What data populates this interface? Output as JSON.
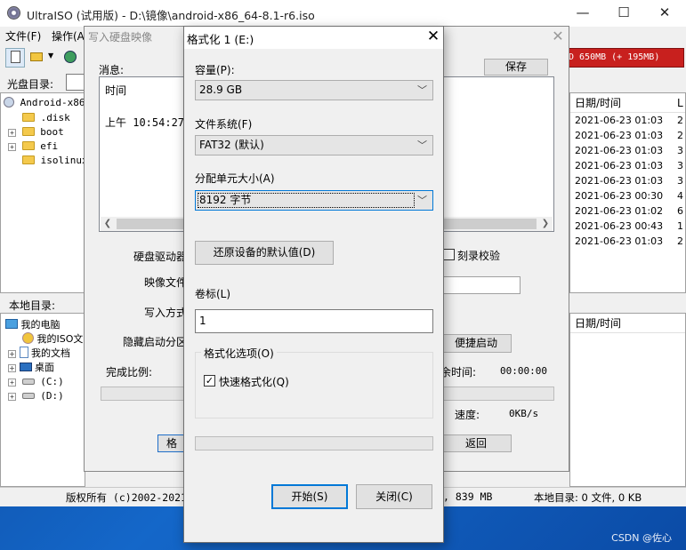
{
  "main_window": {
    "title": "UltraISO (试用版) - D:\\镜像\\android-x86_64-8.1-r6.iso",
    "controls": {
      "minimize": "—",
      "maximize": "☐",
      "close": "✕"
    },
    "menu": [
      "文件(F)",
      "操作(A"
    ],
    "disc_label": "光盘目录:",
    "size_indicator": "D 650MB (+ 195MB)",
    "disc_tree": [
      {
        "label": "Android-x86",
        "icon": "disc-icon"
      },
      {
        "label": ".disk",
        "icon": "folder-icon"
      },
      {
        "label": "boot",
        "icon": "folder-icon"
      },
      {
        "label": "efi",
        "icon": "folder-icon"
      },
      {
        "label": "isolinux",
        "icon": "folder-icon"
      }
    ],
    "local_label": "本地目录:",
    "local_tree": [
      {
        "label": "我的电脑",
        "icon": "computer-icon"
      },
      {
        "label": "我的ISO文",
        "icon": "iso-icon"
      },
      {
        "label": "我的文档",
        "icon": "document-icon"
      },
      {
        "label": "桌面",
        "icon": "desktop-icon"
      },
      {
        "label": "(C:)",
        "icon": "drive-icon"
      },
      {
        "label": "(D:)",
        "icon": "drive-icon"
      }
    ],
    "disc_files": {
      "header": "日期/时间",
      "header_trunc": "L",
      "rows": [
        {
          "date": "2021-06-23 01:03",
          "extra": "2"
        },
        {
          "date": "2021-06-23 01:03",
          "extra": "2"
        },
        {
          "date": "2021-06-23 01:03",
          "extra": "3"
        },
        {
          "date": "2021-06-23 01:03",
          "extra": "3"
        },
        {
          "date": "2021-06-23 01:03",
          "extra": "3"
        },
        {
          "date": "2021-06-23 00:30",
          "extra": "4"
        },
        {
          "date": "2021-06-23 01:02",
          "extra": "6"
        },
        {
          "date": "2021-06-23 00:43",
          "extra": "1"
        },
        {
          "date": "2021-06-23 01:03",
          "extra": "2"
        }
      ]
    },
    "local_files": {
      "header": "日期/时间"
    },
    "status": {
      "copyright": "版权所有 (c)2002-2021",
      "disc_info": ", 839 MB",
      "local_info": "本地目录: 0 文件, 0 KB"
    },
    "watermark": "CSDN @佐心"
  },
  "write_dialog": {
    "title": "写入硬盘映像",
    "close": "✕",
    "message_label": "消息:",
    "save_button": "保存",
    "messages": [
      "时间",
      "上午 10:54:27"
    ],
    "drive_label": "硬盘驱动器",
    "image_label": "映像文件",
    "write_mode_label": "写入方式",
    "hidden_partition_label": "隐藏启动分区",
    "verify_label": "刻录校验",
    "boot_button": "便捷启动",
    "progress_label": "完成比例:",
    "remaining_label": "余时间:",
    "remaining_value": "00:00:00",
    "speed_label": "速度:",
    "speed_value": "0KB/s",
    "back_button": "返回",
    "stub_button": "格"
  },
  "format_dialog": {
    "title": "格式化 1 (E:)",
    "close": "✕",
    "capacity_label": "容量(P):",
    "capacity_value": "28.9 GB",
    "filesystem_label": "文件系统(F)",
    "filesystem_value": "FAT32 (默认)",
    "cluster_label": "分配单元大小(A)",
    "cluster_value": "8192 字节",
    "restore_button": "还原设备的默认值(D)",
    "volume_label": "卷标(L)",
    "volume_value": "1",
    "options_label": "格式化选项(O)",
    "quick_format_label": "快速格式化(Q)",
    "quick_format_checked": true,
    "start_button": "开始(S)",
    "close_button": "关闭(C)"
  }
}
